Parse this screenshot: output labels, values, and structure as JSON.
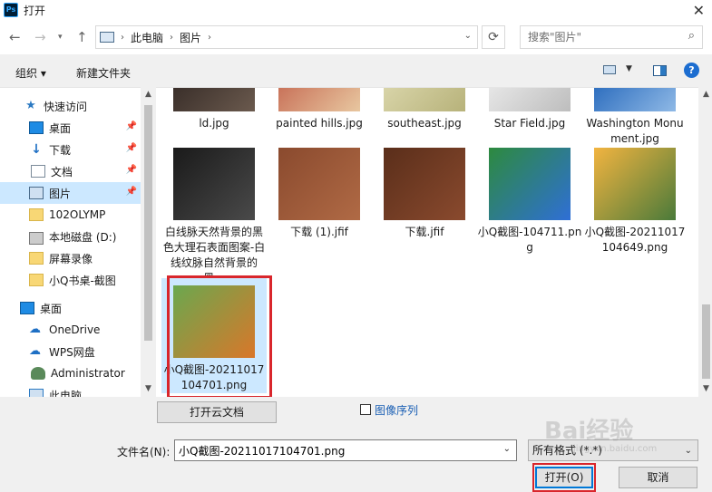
{
  "window": {
    "title": "打开",
    "app_icon_text": "Ps"
  },
  "nav": {
    "breadcrumb": [
      "此电脑",
      "图片"
    ],
    "search_placeholder": "搜索\"图片\""
  },
  "toolbar": {
    "organize": "组织 ▾",
    "new_folder": "新建文件夹",
    "help": "?"
  },
  "sidebar": {
    "items": [
      {
        "label": "快速访问",
        "icon": "star-icon"
      },
      {
        "label": "桌面",
        "icon": "desktop-icon",
        "pinned": true
      },
      {
        "label": "下载",
        "icon": "download-icon",
        "pinned": true
      },
      {
        "label": "文档",
        "icon": "document-icon",
        "pinned": true
      },
      {
        "label": "图片",
        "icon": "pictures-icon",
        "pinned": true,
        "selected": true
      },
      {
        "label": "102OLYMP",
        "icon": "folder-icon"
      },
      {
        "label": "本地磁盘 (D:)",
        "icon": "disk-icon"
      },
      {
        "label": "屏幕录像",
        "icon": "folder-icon"
      },
      {
        "label": "小Q书桌-截图",
        "icon": "folder-icon"
      },
      {
        "label": "桌面",
        "icon": "desktop-icon"
      },
      {
        "label": "OneDrive",
        "icon": "cloud-icon"
      },
      {
        "label": "WPS网盘",
        "icon": "cloud-icon"
      },
      {
        "label": "Administrator",
        "icon": "user-icon"
      },
      {
        "label": "此电脑",
        "icon": "pc-icon"
      }
    ]
  },
  "files": [
    {
      "name": "ld.jpg",
      "colors": [
        "#3a2f2a",
        "#6b5a4e"
      ]
    },
    {
      "name": "painted hills.jpg",
      "colors": [
        "#c9735a",
        "#e8c7a0"
      ]
    },
    {
      "name": "southeast.jpg",
      "colors": [
        "#d8d4a8",
        "#b7b27a"
      ]
    },
    {
      "name": "Star Field.jpg",
      "colors": [
        "#e6e6e6",
        "#bdbdbd"
      ]
    },
    {
      "name": "Washington Monument.jpg",
      "colors": [
        "#2f6fbf",
        "#8fb9e6"
      ]
    },
    {
      "name": "白线脉天然背景的黑色大理石表面图案-白线纹脉自然背景的黑...",
      "colors": [
        "#1a1a1a",
        "#4a4a4a"
      ]
    },
    {
      "name": "下载 (1).jfif",
      "colors": [
        "#8a4a2e",
        "#b06a45"
      ]
    },
    {
      "name": "下载.jfif",
      "colors": [
        "#5a2e1a",
        "#8a4a2e"
      ]
    },
    {
      "name": "小Q截图-104711.png",
      "colors": [
        "#2d8a3e",
        "#2f6fd6"
      ]
    },
    {
      "name": "小Q截图-20211017104649.png",
      "colors": [
        "#f2b440",
        "#4a7a3a"
      ]
    },
    {
      "name": "小Q截图-20211017104701.png",
      "colors": [
        "#6aa84f",
        "#d9772a"
      ],
      "selected": true
    }
  ],
  "bottom": {
    "cloud_doc_button": "打开云文档",
    "image_sequence": "图像序列",
    "filename_label": "文件名(N):",
    "filename_value": "小Q截图-20211017104701.png",
    "filetype_value": "所有格式 (*.*)",
    "open_button": "打开(O)",
    "cancel_button": "取消"
  },
  "watermark": {
    "text": "Bai经验",
    "sub": "jingyan.baidu.com"
  }
}
